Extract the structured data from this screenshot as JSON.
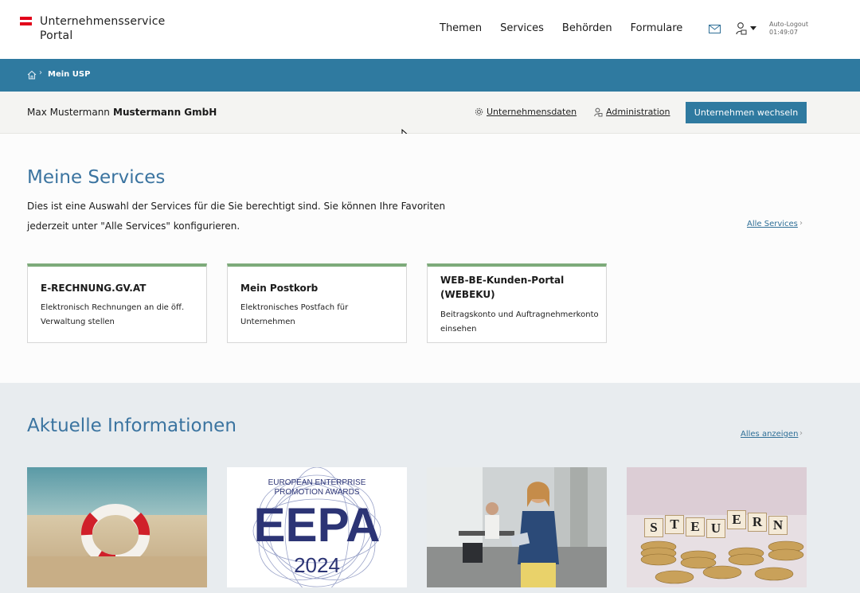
{
  "header": {
    "logo_line1": "Unternehmensservice",
    "logo_line2": "Portal",
    "nav": [
      "Themen",
      "Services",
      "Behörden",
      "Formulare"
    ],
    "autologout_label": "Auto-Logout",
    "autologout_time": "01:49:07",
    "icons": [
      "mail-icon",
      "user-icon",
      "caret-down-icon"
    ]
  },
  "breadcrumb": {
    "home_icon": "home-icon",
    "separator": "›",
    "current": "Mein USP"
  },
  "companybar": {
    "user_name": "Max Mustermann",
    "company_name": "Mustermann GmbH",
    "company_data_label": "Unternehmensdaten",
    "administration_label": "Administration",
    "switch_button": "Unternehmen wechseln"
  },
  "services": {
    "title": "Meine Services",
    "intro_line1": "Dies ist eine Auswahl der Services für die Sie berechtigt sind. Sie können Ihre Favoriten",
    "intro_line2": "jederzeit unter \"Alle Services\" konfigurieren.",
    "all_link": "Alle Services",
    "chevron": "›",
    "cards": [
      {
        "title": "E-RECHNUNG.GV.AT",
        "desc_line1": "Elektronisch Rechnungen an die öff.",
        "desc_line2": "Verwaltung stellen"
      },
      {
        "title": "Mein Postkorb",
        "desc_line1": "Elektronisches Postfach für",
        "desc_line2": "Unternehmen"
      },
      {
        "title_line1": "WEB-BE-Kunden-Portal",
        "title_line2": "(WEBEKU)",
        "desc_line1": "Beitragskonto und Auftragnehmerkonto",
        "desc_line2": "einsehen"
      }
    ],
    "accent_color": "#7dab7a"
  },
  "info": {
    "title": "Aktuelle Informationen",
    "all_link": "Alles anzeigen",
    "chevron": "›",
    "eepa_line1": "EUROPEAN ENTERPRISE",
    "eepa_line2": "PROMOTION AWARDS",
    "eepa_big": "EEPA",
    "eepa_year": "2024",
    "steuern_letters": [
      "S",
      "T",
      "E",
      "U",
      "E",
      "R",
      "N"
    ]
  },
  "colors": {
    "primary": "#2f7aa0",
    "heading": "#3b74a0",
    "austria_red": "#e2001a"
  }
}
